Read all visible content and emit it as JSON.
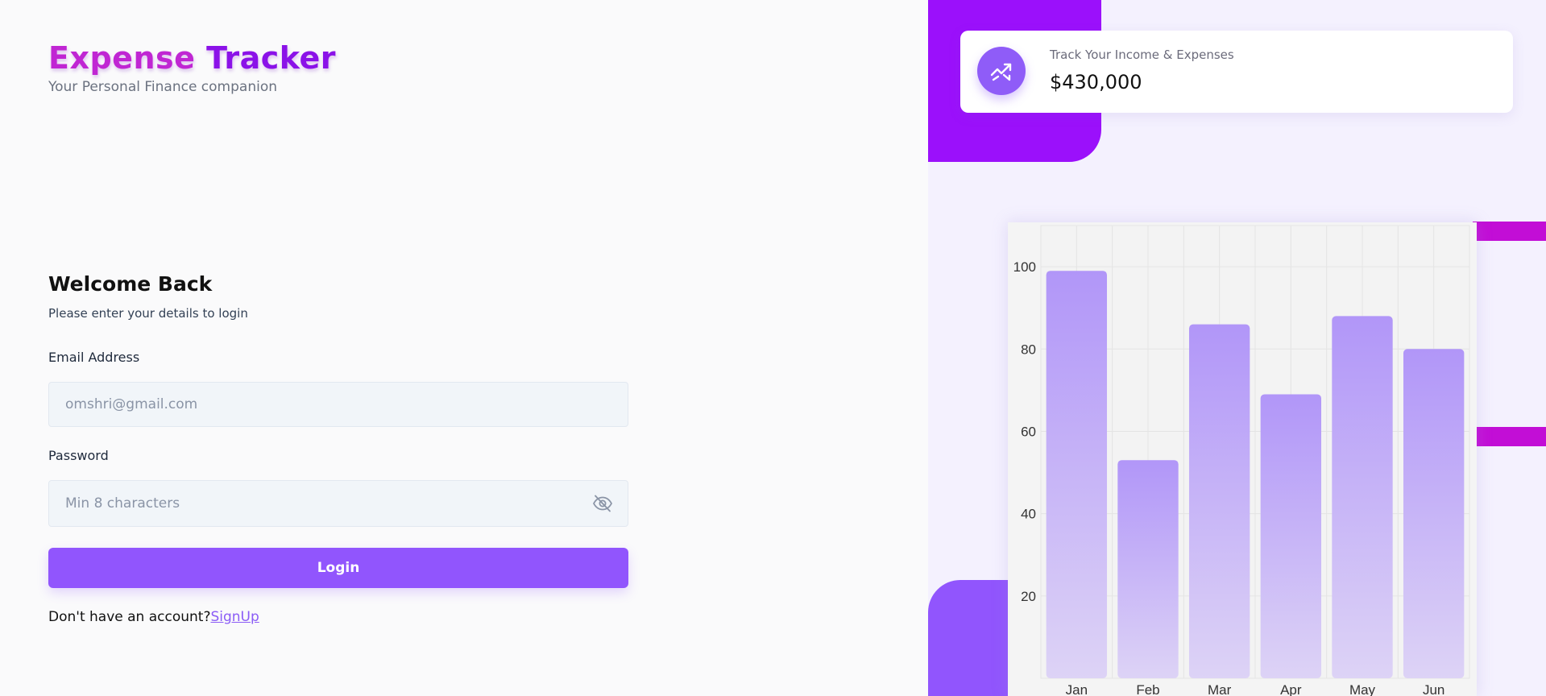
{
  "app": {
    "title_part1": "Expense",
    "title_part2": "Tracker",
    "subtitle": "Your Personal Finance companion"
  },
  "login": {
    "heading": "Welcome Back",
    "subheading": "Please enter your details to login",
    "email": {
      "label": "Email Address",
      "placeholder": "omshri@gmail.com",
      "value": ""
    },
    "password": {
      "label": "Password",
      "placeholder": "Min 8 characters",
      "value": "",
      "toggle_icon": "eye-off-icon"
    },
    "submit_label": "Login",
    "signup_prompt": "Don't have an account?",
    "signup_link": "SignUp"
  },
  "stat_card": {
    "icon": "trending-up-icon",
    "label": "Track Your Income & Expenses",
    "value": "$430,000"
  },
  "colors": {
    "accent": "#9155fd",
    "brand_purple": "#9b10fb",
    "brand_magenta": "#c20ed6",
    "bar_top": "#b196f8",
    "bar_bottom": "#ddd3f6"
  },
  "chart_data": {
    "type": "bar",
    "categories": [
      "Jan",
      "Feb",
      "Mar",
      "Apr",
      "May",
      "Jun"
    ],
    "values": [
      99,
      53,
      86,
      69,
      88,
      80
    ],
    "ylim": [
      0,
      110
    ],
    "yticks": [
      20,
      40,
      60,
      80,
      100
    ],
    "grid": true,
    "title": "",
    "xlabel": "",
    "ylabel": ""
  }
}
